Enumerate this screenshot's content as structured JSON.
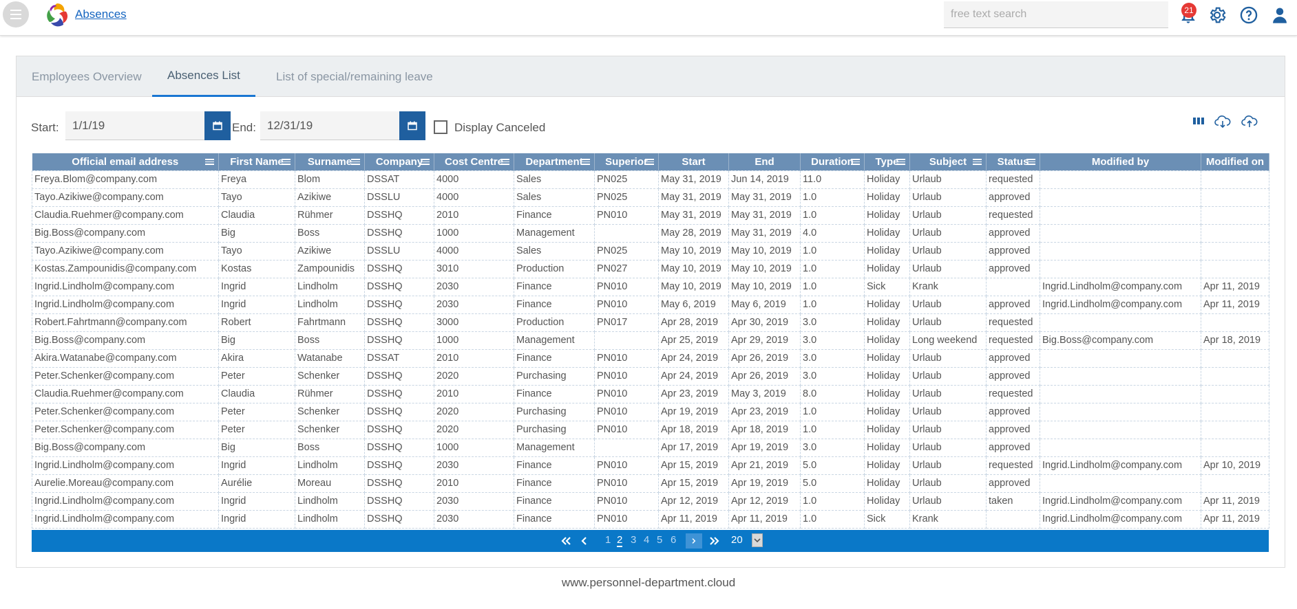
{
  "header": {
    "app_title": "Absences",
    "search_placeholder": "free text search",
    "notification_count": "21"
  },
  "tabs": [
    {
      "label": "Employees Overview",
      "active": false
    },
    {
      "label": "Absences List",
      "active": true
    },
    {
      "label": "List of special/remaining leave",
      "active": false
    }
  ],
  "filters": {
    "start_label": "Start:",
    "start_value": "1/1/19",
    "end_label": "End:",
    "end_value": "12/31/19",
    "display_canceled_label": "Display Canceled"
  },
  "table": {
    "columns": [
      "Official email address",
      "First Name",
      "Surname",
      "Company",
      "Cost Centre",
      "Department",
      "Superior",
      "Start",
      "End",
      "Duration",
      "Type",
      "Subject",
      "Status",
      "Modified by",
      "Modified on"
    ],
    "rows": [
      [
        "Freya.Blom@company.com",
        "Freya",
        "Blom",
        "DSSAT",
        "4000",
        "Sales",
        "PN025",
        "May 31, 2019",
        "Jun 14, 2019",
        "11.0",
        "Holiday",
        "Urlaub",
        "requested",
        "",
        ""
      ],
      [
        "Tayo.Azikiwe@company.com",
        "Tayo",
        "Azikiwe",
        "DSSLU",
        "4000",
        "Sales",
        "PN025",
        "May 31, 2019",
        "May 31, 2019",
        "1.0",
        "Holiday",
        "Urlaub",
        "approved",
        "",
        ""
      ],
      [
        "Claudia.Ruehmer@company.com",
        "Claudia",
        "Rühmer",
        "DSSHQ",
        "2010",
        "Finance",
        "PN010",
        "May 31, 2019",
        "May 31, 2019",
        "1.0",
        "Holiday",
        "Urlaub",
        "requested",
        "",
        ""
      ],
      [
        "Big.Boss@company.com",
        "Big",
        "Boss",
        "DSSHQ",
        "1000",
        "Management",
        "",
        "May 28, 2019",
        "May 31, 2019",
        "4.0",
        "Holiday",
        "Urlaub",
        "approved",
        "",
        ""
      ],
      [
        "Tayo.Azikiwe@company.com",
        "Tayo",
        "Azikiwe",
        "DSSLU",
        "4000",
        "Sales",
        "PN025",
        "May 10, 2019",
        "May 10, 2019",
        "1.0",
        "Holiday",
        "Urlaub",
        "approved",
        "",
        ""
      ],
      [
        "Kostas.Zampounidis@company.com",
        "Kostas",
        "Zampounidis",
        "DSSHQ",
        "3010",
        "Production",
        "PN027",
        "May 10, 2019",
        "May 10, 2019",
        "1.0",
        "Holiday",
        "Urlaub",
        "approved",
        "",
        ""
      ],
      [
        "Ingrid.Lindholm@company.com",
        "Ingrid",
        "Lindholm",
        "DSSHQ",
        "2030",
        "Finance",
        "PN010",
        "May 10, 2019",
        "May 10, 2019",
        "1.0",
        "Sick",
        "Krank",
        "",
        "Ingrid.Lindholm@company.com",
        "Apr 11, 2019"
      ],
      [
        "Ingrid.Lindholm@company.com",
        "Ingrid",
        "Lindholm",
        "DSSHQ",
        "2030",
        "Finance",
        "PN010",
        "May 6, 2019",
        "May 6, 2019",
        "1.0",
        "Holiday",
        "Urlaub",
        "approved",
        "Ingrid.Lindholm@company.com",
        "Apr 11, 2019"
      ],
      [
        "Robert.Fahrtmann@company.com",
        "Robert",
        "Fahrtmann",
        "DSSHQ",
        "3000",
        "Production",
        "PN017",
        "Apr 28, 2019",
        "Apr 30, 2019",
        "3.0",
        "Holiday",
        "Urlaub",
        "requested",
        "",
        ""
      ],
      [
        "Big.Boss@company.com",
        "Big",
        "Boss",
        "DSSHQ",
        "1000",
        "Management",
        "",
        "Apr 25, 2019",
        "Apr 29, 2019",
        "3.0",
        "Holiday",
        "Long weekend",
        "requested",
        "Big.Boss@company.com",
        "Apr 18, 2019"
      ],
      [
        "Akira.Watanabe@company.com",
        "Akira",
        "Watanabe",
        "DSSAT",
        "2010",
        "Finance",
        "PN010",
        "Apr 24, 2019",
        "Apr 26, 2019",
        "3.0",
        "Holiday",
        "Urlaub",
        "approved",
        "",
        ""
      ],
      [
        "Peter.Schenker@company.com",
        "Peter",
        "Schenker",
        "DSSHQ",
        "2020",
        "Purchasing",
        "PN010",
        "Apr 24, 2019",
        "Apr 26, 2019",
        "3.0",
        "Holiday",
        "Urlaub",
        "approved",
        "",
        ""
      ],
      [
        "Claudia.Ruehmer@company.com",
        "Claudia",
        "Rühmer",
        "DSSHQ",
        "2010",
        "Finance",
        "PN010",
        "Apr 23, 2019",
        "May 3, 2019",
        "8.0",
        "Holiday",
        "Urlaub",
        "requested",
        "",
        ""
      ],
      [
        "Peter.Schenker@company.com",
        "Peter",
        "Schenker",
        "DSSHQ",
        "2020",
        "Purchasing",
        "PN010",
        "Apr 19, 2019",
        "Apr 23, 2019",
        "1.0",
        "Holiday",
        "Urlaub",
        "approved",
        "",
        ""
      ],
      [
        "Peter.Schenker@company.com",
        "Peter",
        "Schenker",
        "DSSHQ",
        "2020",
        "Purchasing",
        "PN010",
        "Apr 18, 2019",
        "Apr 18, 2019",
        "1.0",
        "Holiday",
        "Urlaub",
        "approved",
        "",
        ""
      ],
      [
        "Big.Boss@company.com",
        "Big",
        "Boss",
        "DSSHQ",
        "1000",
        "Management",
        "",
        "Apr 17, 2019",
        "Apr 19, 2019",
        "3.0",
        "Holiday",
        "Urlaub",
        "approved",
        "",
        ""
      ],
      [
        "Ingrid.Lindholm@company.com",
        "Ingrid",
        "Lindholm",
        "DSSHQ",
        "2030",
        "Finance",
        "PN010",
        "Apr 15, 2019",
        "Apr 21, 2019",
        "5.0",
        "Holiday",
        "Urlaub",
        "requested",
        "Ingrid.Lindholm@company.com",
        "Apr 10, 2019"
      ],
      [
        "Aurelie.Moreau@company.com",
        "Aurélie",
        "Moreau",
        "DSSHQ",
        "2010",
        "Finance",
        "PN010",
        "Apr 15, 2019",
        "Apr 19, 2019",
        "5.0",
        "Holiday",
        "Urlaub",
        "approved",
        "",
        ""
      ],
      [
        "Ingrid.Lindholm@company.com",
        "Ingrid",
        "Lindholm",
        "DSSHQ",
        "2030",
        "Finance",
        "PN010",
        "Apr 12, 2019",
        "Apr 12, 2019",
        "1.0",
        "Holiday",
        "Urlaub",
        "taken",
        "Ingrid.Lindholm@company.com",
        "Apr 11, 2019"
      ],
      [
        "Ingrid.Lindholm@company.com",
        "Ingrid",
        "Lindholm",
        "DSSHQ",
        "2030",
        "Finance",
        "PN010",
        "Apr 11, 2019",
        "Apr 11, 2019",
        "1.0",
        "Sick",
        "Krank",
        "",
        "Ingrid.Lindholm@company.com",
        "Apr 11, 2019"
      ]
    ]
  },
  "pager": {
    "pages": [
      "1",
      "2",
      "3",
      "4",
      "5",
      "6"
    ],
    "current_page": "2",
    "page_size": "20"
  },
  "footer": {
    "text": "www.personnel-department.cloud"
  },
  "colors": {
    "header_bg": "#6b8fb5",
    "pager_bg": "#0a78c8",
    "accent": "#1976d2",
    "badge": "#e53935"
  },
  "icons": {
    "menu": "hamburger-icon",
    "notifications": "bell-icon",
    "settings": "gear-icon",
    "help": "help-circle-icon",
    "user": "user-icon",
    "calendar": "calendar-icon",
    "columns": "columns-icon",
    "download": "cloud-download-icon",
    "upload": "cloud-upload-icon"
  }
}
